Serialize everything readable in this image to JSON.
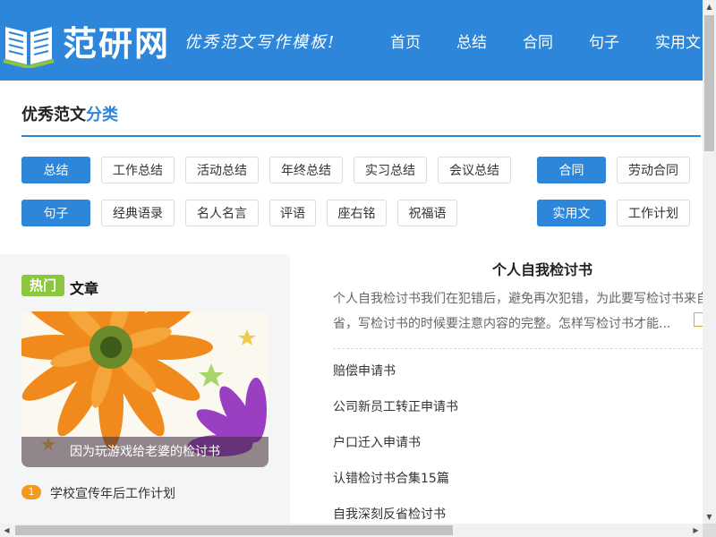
{
  "site": {
    "logo_text": "范研网",
    "slogan": "优秀范文写作模板!",
    "logo_icon": "open-book-icon"
  },
  "nav": [
    "首页",
    "总结",
    "合同",
    "句子",
    "实用文"
  ],
  "category": {
    "title_plain": "优秀范文",
    "title_accent": "分类"
  },
  "tags": {
    "row1_primary": "总结",
    "row1": [
      "工作总结",
      "活动总结",
      "年终总结",
      "实习总结",
      "会议总结"
    ],
    "row1_primary2": "合同",
    "row1_extra": [
      "劳动合同"
    ],
    "row2_primary": "句子",
    "row2": [
      "经典语录",
      "名人名言",
      "评语",
      "座右铭",
      "祝福语"
    ],
    "row2_primary2": "实用文",
    "row2_extra": [
      "工作计划"
    ]
  },
  "hot": {
    "badge": "热门",
    "title": "文章",
    "image_caption": "因为玩游戏给老婆的检讨书",
    "list": [
      {
        "num": "1",
        "title": "学校宣传年后工作计划"
      }
    ]
  },
  "feature": {
    "title": "个人自我检讨书",
    "summary_line1": "个人自我检讨书我们在犯错后，避免再次犯错，为此要写检讨书来自",
    "summary_line2": "省，写检讨书的时候要注意内容的完整。怎样写检讨书才能..."
  },
  "articles": [
    "赔偿申请书",
    "公司新员工转正申请书",
    "户口迁入申请书",
    "认错检讨书合集15篇",
    "自我深刻反省检讨书"
  ],
  "colors": {
    "brand_blue": "#2d86d9",
    "hot_green": "#8cc63f",
    "number_orange": "#f39a1c"
  }
}
